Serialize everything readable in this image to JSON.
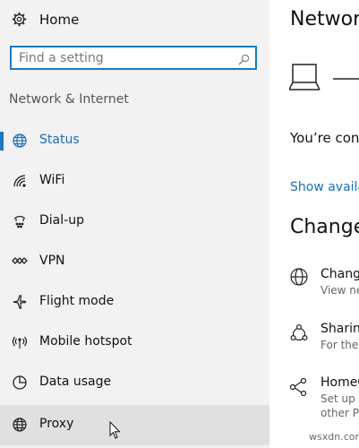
{
  "sidebar": {
    "home_label": "Home",
    "search_placeholder": "Find a setting",
    "section_title": "Network & Internet",
    "items": [
      {
        "label": "Status",
        "icon": "globe-icon",
        "active": true
      },
      {
        "label": "WiFi",
        "icon": "wifi-icon"
      },
      {
        "label": "Dial-up",
        "icon": "dialup-icon"
      },
      {
        "label": "VPN",
        "icon": "vpn-icon"
      },
      {
        "label": "Flight mode",
        "icon": "airplane-icon"
      },
      {
        "label": "Mobile hotspot",
        "icon": "hotspot-icon"
      },
      {
        "label": "Data usage",
        "icon": "data-usage-icon"
      },
      {
        "label": "Proxy",
        "icon": "globe-icon",
        "hover": true
      }
    ]
  },
  "main": {
    "title": "Network",
    "connected_text": "You’re con",
    "show_link": "Show availab",
    "change_heading": "Change",
    "options": [
      {
        "title": "Change",
        "desc": [
          "View ne"
        ],
        "icon": "adapter-icon"
      },
      {
        "title": "Sharing",
        "desc": [
          "For the n"
        ],
        "icon": "sharing-icon"
      },
      {
        "title": "HomeG",
        "desc": [
          "Set up a",
          "other PC"
        ],
        "icon": "homegroup-icon"
      }
    ]
  },
  "watermark": "wsxdn.com",
  "colors": {
    "accent": "#1b79c8",
    "sidebar_bg": "#f2f2f2",
    "hover_bg": "#e0e0e0"
  }
}
